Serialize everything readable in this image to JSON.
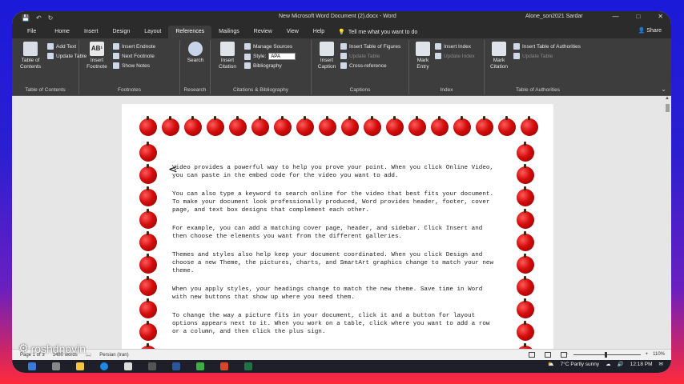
{
  "window": {
    "title": "New Microsoft Word Document (2).docx - Word",
    "user": "Alone_son2021 Sardar"
  },
  "tabs": [
    "File",
    "Home",
    "Insert",
    "Design",
    "Layout",
    "References",
    "Mailings",
    "Review",
    "View",
    "Help"
  ],
  "active_tab": "References",
  "tell_me": "Tell me what you want to do",
  "share": "Share",
  "ribbon": {
    "toc": {
      "big": "Table of Contents",
      "add_text": "Add Text",
      "update_table": "Update Table",
      "label": "Table of Contents"
    },
    "footnotes": {
      "big": "Insert Footnote",
      "insert_endnote": "Insert Endnote",
      "next_footnote": "Next Footnote",
      "show_notes": "Show Notes",
      "label": "Footnotes"
    },
    "research": {
      "big": "Search",
      "label": "Research"
    },
    "citations": {
      "big": "Insert Citation",
      "manage_sources": "Manage Sources",
      "style_label": "Style:",
      "style_value": "APA",
      "bibliography": "Bibliography",
      "label": "Citations & Bibliography"
    },
    "captions": {
      "big": "Insert Caption",
      "insert_table_of_figures": "Insert Table of Figures",
      "update_table": "Update Table",
      "cross_reference": "Cross-reference",
      "label": "Captions"
    },
    "index": {
      "big": "Mark Entry",
      "insert_index": "Insert Index",
      "update_index": "Update Index",
      "label": "Index"
    },
    "authorities": {
      "big": "Mark Citation",
      "insert_table_of_authorities": "Insert Table of Authorities",
      "update_table": "Update Table",
      "label": "Table of Authorities"
    }
  },
  "document": {
    "paragraphs": [
      "Video provides a powerful way to help you prove your point. When you click Online Video, you can paste in the embed code for the video you want to add.",
      "You can also type a keyword to search online for the video that best fits your document. To make your document look professionally produced, Word provides header, footer, cover page, and text box designs that complement each other.",
      "For example, you can add a matching cover page, header, and sidebar. Click Insert and then choose the elements you want from the different galleries.",
      "Themes and styles also help keep your document coordinated. When you click Design and choose a new Theme, the pictures, charts, and SmartArt graphics change to match your new theme.",
      "When you apply styles, your headings change to match the new theme. Save time in Word with new buttons that show up where you need them.",
      "To change the way a picture fits in your document, click it and a button for layout options appears next to it. When you work on a table, click where you want to add a row or a column, and then click the plus sign."
    ]
  },
  "status": {
    "page": "Page 1 of 3",
    "words": "1480 words",
    "language": "Persian (Iran)",
    "zoom": "110%"
  },
  "taskbar": {
    "weather": "7°C  Partly sunny",
    "time": "12:18 PM"
  },
  "watermark": "roshdnovin"
}
